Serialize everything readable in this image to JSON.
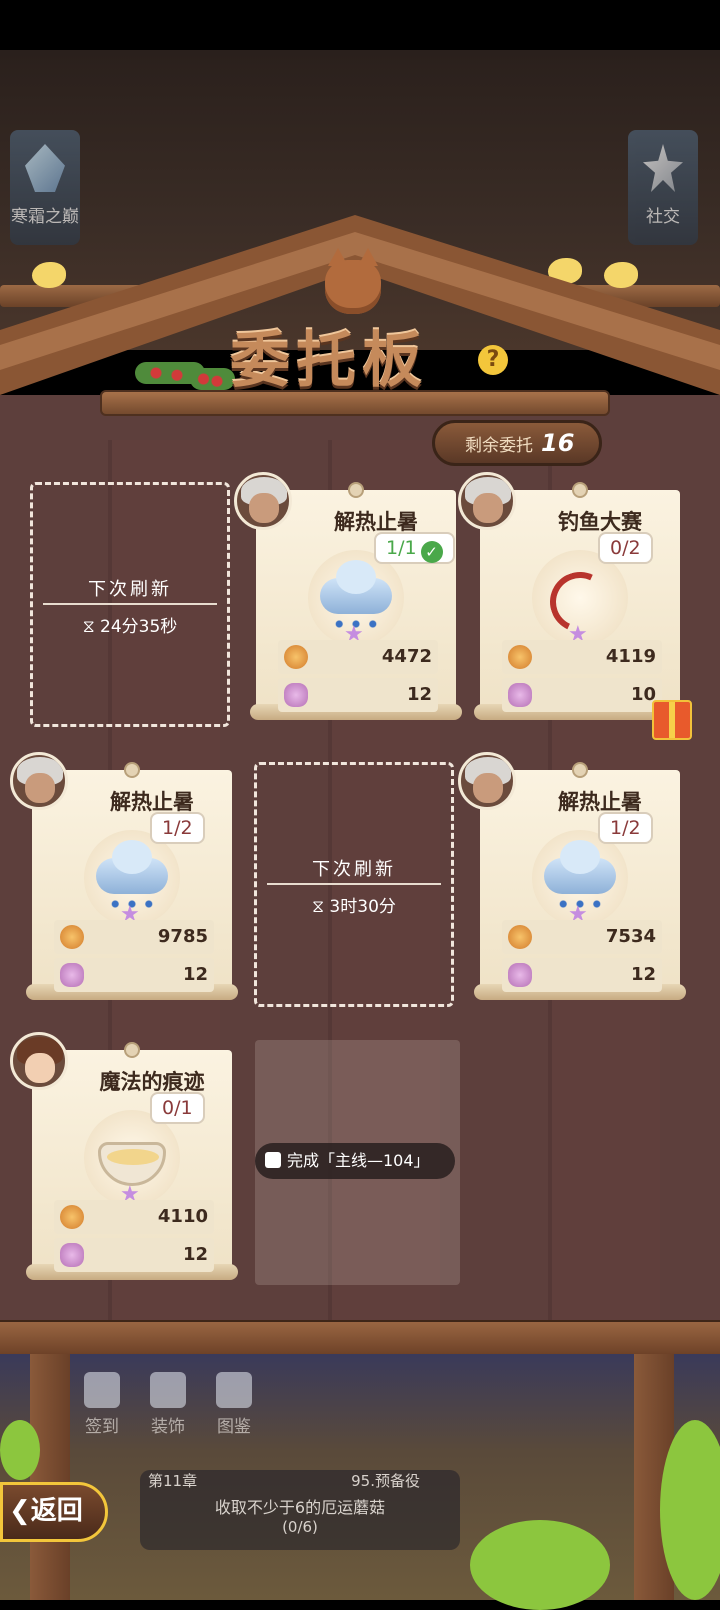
{
  "top": {
    "left_button_label": "寒霜之巅",
    "right_button_label": "社交"
  },
  "board": {
    "title": "委托板",
    "remaining_label": "剩余委托",
    "remaining_count": "16"
  },
  "refresh_slots": [
    {
      "label": "下次刷新",
      "timer": "⧖ 24分35秒"
    },
    {
      "label": "下次刷新",
      "timer": "⧖ 3时30分"
    }
  ],
  "cards": [
    {
      "name": "解热止暑",
      "progress": "1/1",
      "completed": true,
      "item": "cloud-icon",
      "gold": "4472",
      "gems": "12"
    },
    {
      "name": "钓鱼大赛",
      "progress": "0/2",
      "completed": false,
      "item": "fishing-rod-icon",
      "gold": "4119",
      "gems": "10"
    },
    {
      "name": "解热止暑",
      "progress": "1/2",
      "completed": false,
      "item": "cloud-icon",
      "gold": "9785",
      "gems": "12"
    },
    {
      "name": "解热止暑",
      "progress": "1/2",
      "completed": false,
      "item": "cloud-icon",
      "gold": "7534",
      "gems": "12"
    },
    {
      "name": "魔法的痕迹",
      "progress": "0/1",
      "completed": false,
      "item": "soup-bowl-icon",
      "gold": "4110",
      "gems": "12"
    }
  ],
  "locked_slot": {
    "text": "完成「主线—104」"
  },
  "bottom_nav": [
    {
      "label": "签到",
      "icon": "calendar-icon"
    },
    {
      "label": "装饰",
      "icon": "decoration-icon"
    },
    {
      "label": "图鉴",
      "icon": "book-icon"
    }
  ],
  "back_button": "返回",
  "task_bar": {
    "chapter": "第11章",
    "reserve": "95.预备役",
    "description": "收取不少于6的厄运蘑菇",
    "progress": "(0/6)"
  },
  "colors": {
    "board_wood": "#5d3f3c",
    "paper": "#fbf3e1",
    "done_green": "#4aa84a"
  }
}
